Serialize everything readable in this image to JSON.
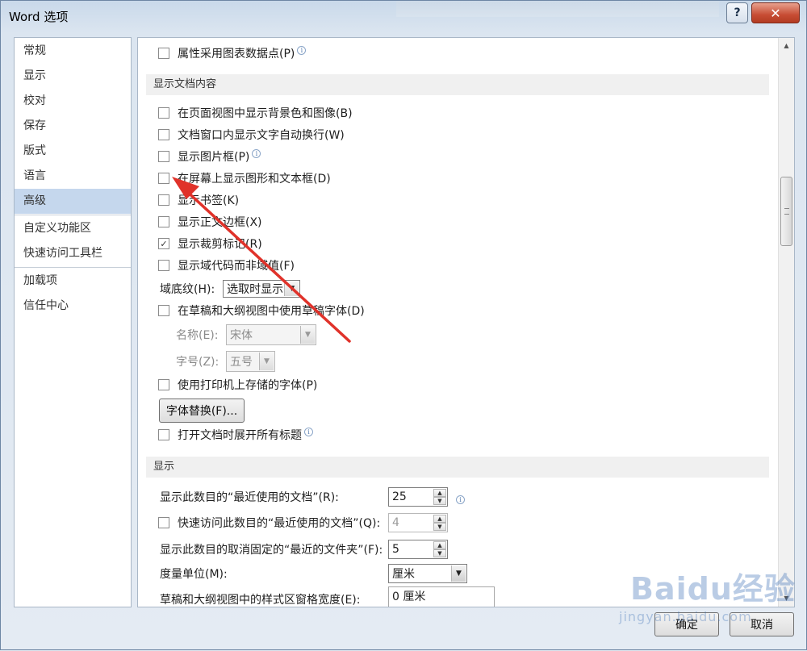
{
  "window": {
    "title": "Word 选项",
    "help_glyph": "?",
    "close_glyph": "✕"
  },
  "nav": {
    "items": [
      "常规",
      "显示",
      "校对",
      "保存",
      "版式",
      "语言",
      "高级",
      "自定义功能区",
      "快速访问工具栏",
      "加载项",
      "信任中心"
    ],
    "active": "高级"
  },
  "content": {
    "top_option": "属性采用图表数据点(P)",
    "section_doc_content": "显示文档内容",
    "doc_options": [
      {
        "label": "在页面视图中显示背景色和图像(B)",
        "checked": false
      },
      {
        "label": "文档窗口内显示文字自动换行(W)",
        "checked": false
      },
      {
        "label": "显示图片框(P)",
        "checked": false
      },
      {
        "label": "在屏幕上显示图形和文本框(D)",
        "checked": false
      },
      {
        "label": "显示书签(K)",
        "checked": false
      },
      {
        "label": "显示正文边框(X)",
        "checked": false
      },
      {
        "label": "显示裁剪标记(R)",
        "checked": true
      },
      {
        "label": "显示域代码而非域值(F)",
        "checked": false
      }
    ],
    "field_shading_label": "域底纹(H):",
    "field_shading_value": "选取时显示",
    "draft_font_option": "在草稿和大纲视图中使用草稿字体(D)",
    "font_name_label": "名称(E):",
    "font_name_value": "宋体",
    "font_size_label": "字号(Z):",
    "font_size_value": "五号",
    "printer_fonts_option": "使用打印机上存储的字体(P)",
    "font_substitution_button": "字体替换(F)...",
    "expand_headings_option": "打开文档时展开所有标题",
    "section_display": "显示",
    "recent_docs_label": "显示此数目的“最近使用的文档”(R):",
    "recent_docs_value": "25",
    "quick_access_label": "快速访问此数目的“最近使用的文档”(Q):",
    "quick_access_value": "4",
    "recent_folders_label": "显示此数目的取消固定的“最近的文件夹”(F):",
    "recent_folders_value": "5",
    "units_label": "度量单位(M):",
    "units_value": "厘米",
    "style_pane_label": "草稿和大纲视图中的样式区窗格宽度(E):",
    "style_pane_value": "0 厘米",
    "check_glyph": "✓",
    "info_glyph": "i",
    "dropdown_glyph": "▼",
    "spin_up_glyph": "▲",
    "spin_down_glyph": "▼"
  },
  "footer": {
    "ok_label": "确定",
    "cancel_label": "取消"
  },
  "watermark": {
    "logo_text": "Baidu经验",
    "url_text": "jingyan.baidu.com"
  },
  "colors": {
    "annotation_arrow": "#e0322a",
    "nav_active": "#c5d7ed",
    "section_header_bg": "#f0f0f0"
  }
}
